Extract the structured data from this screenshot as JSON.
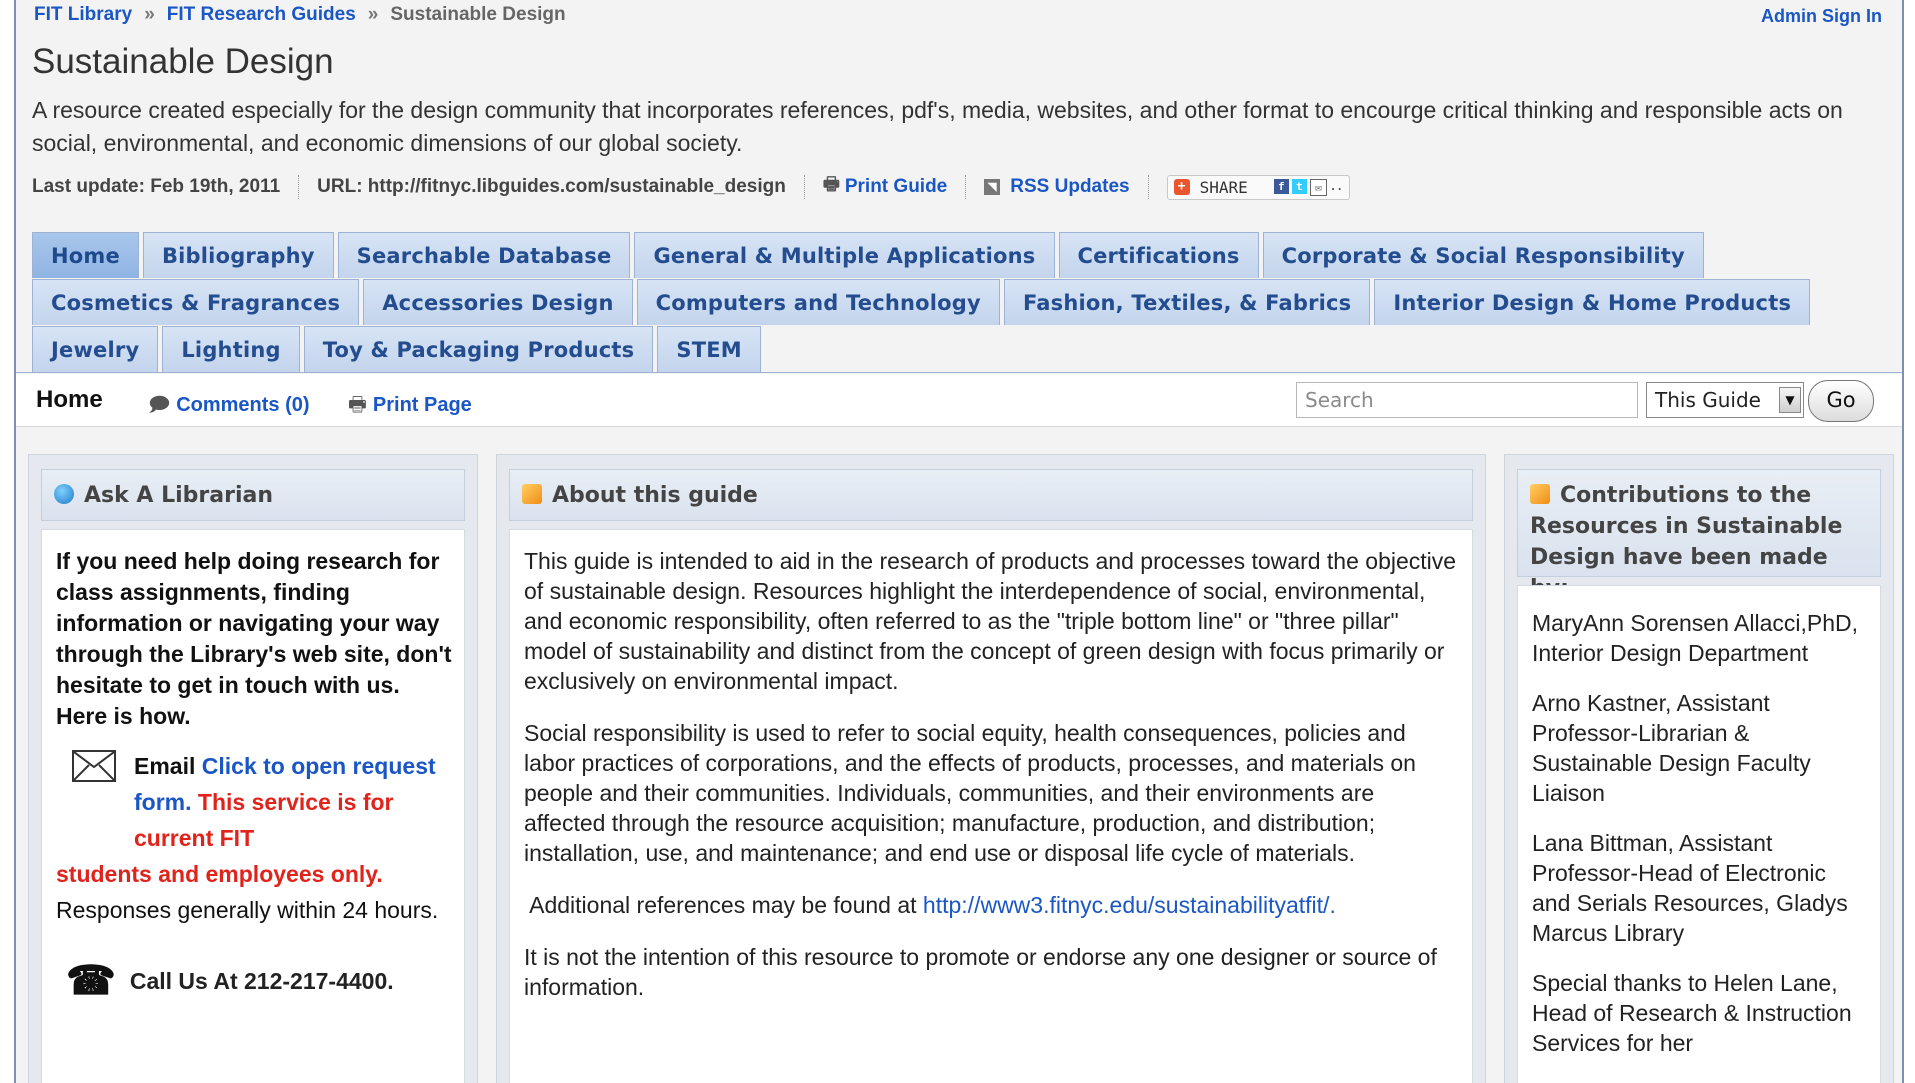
{
  "breadcrumb": {
    "items": [
      "FIT Library",
      "FIT Research Guides",
      "Sustainable Design"
    ],
    "separator": "»"
  },
  "admin_sign_in": "Admin Sign In",
  "page_title": "Sustainable Design",
  "description": "A resource created especially for the design community that incorporates references, pdf's, media, websites, and other format to encourge critical thinking and responsible acts on social, environmental, and economic dimensions of our global society.",
  "meta": {
    "last_update": "Last update: Feb 19th, 2011",
    "url": "URL: http://fitnyc.libguides.com/sustainable_design",
    "print_guide": "Print Guide",
    "rss_updates": "RSS Updates",
    "share": "SHARE"
  },
  "tabs": {
    "row1": [
      "Home",
      "Bibliography",
      "Searchable Database",
      "General & Multiple Applications",
      "Certifications",
      "Corporate & Social Responsibility"
    ],
    "row2": [
      "Cosmetics & Fragrances",
      "Accessories Design",
      "Computers and Technology",
      "Fashion, Textiles, & Fabrics",
      "Interior Design & Home Products"
    ],
    "row3": [
      "Jewelry",
      "Lighting",
      "Toy & Packaging Products",
      "STEM"
    ]
  },
  "pagebar": {
    "current_page": "Home",
    "comments": "Comments (0)",
    "print_page": "Print Page",
    "search_placeholder": "Search",
    "scope": "This Guide",
    "go": "Go"
  },
  "ask_librarian": {
    "title": "Ask A Librarian",
    "intro": "If you need help doing research for class assignments, finding information or navigating your way through the Library's web site, don't hesitate to get in touch with us.  Here is how.",
    "email_label": "Email",
    "email_link": "Click to open request form.",
    "email_note_1": "This service is for current FIT",
    "email_note_2": "students and employees only.",
    "responses": "Responses generally within 24 hours.",
    "call": "Call Us At 212-217-4400."
  },
  "about": {
    "title": "About this guide",
    "p1": "This guide is intended to aid in the research of products and processes toward the objective of sustainable design.  Resources highlight the interdependence of social, environmental, and economic responsibility, often referred to as the \"triple bottom line\" or \"three pillar\" model of sustainability and distinct from the concept of green design with focus primarily or exclusively on environmental impact.",
    "p2": "Social responsibility is used to refer to social equity, health consequences, policies and labor practices of corporations, and the effects of products, processes, and materials on people and their communities.  Individuals, communities, and their environments are affected through the resource acquisition; manufacture, production, and distribution; installation, use, and maintenance; and end use or disposal life cycle of materials.",
    "p3_prefix": " Additional references may be found at ",
    "p3_link": "http://www3.fitnyc.edu/sustainabilityatfit/.",
    "p4": "It is not the intention of this resource to promote or endorse any one designer or source of information."
  },
  "contrib": {
    "title": "Contributions to the Resources in Sustainable Design have been made by:",
    "items": [
      "MaryAnn Sorensen Allacci,PhD, Interior Design Department",
      "Arno Kastner, Assistant Professor-Librarian & Sustainable Design Faculty Liaison",
      "Lana Bittman, Assistant Professor-Head of Electronic and Serials Resources, Gladys Marcus Library",
      "Special thanks to Helen Lane, Head of Research & Instruction Services for her"
    ]
  },
  "colors": {
    "link": "#1a56c4",
    "warning": "#e0231b",
    "tab_bg": "#c3d4ec",
    "active_tab": "#8fb4e4"
  }
}
